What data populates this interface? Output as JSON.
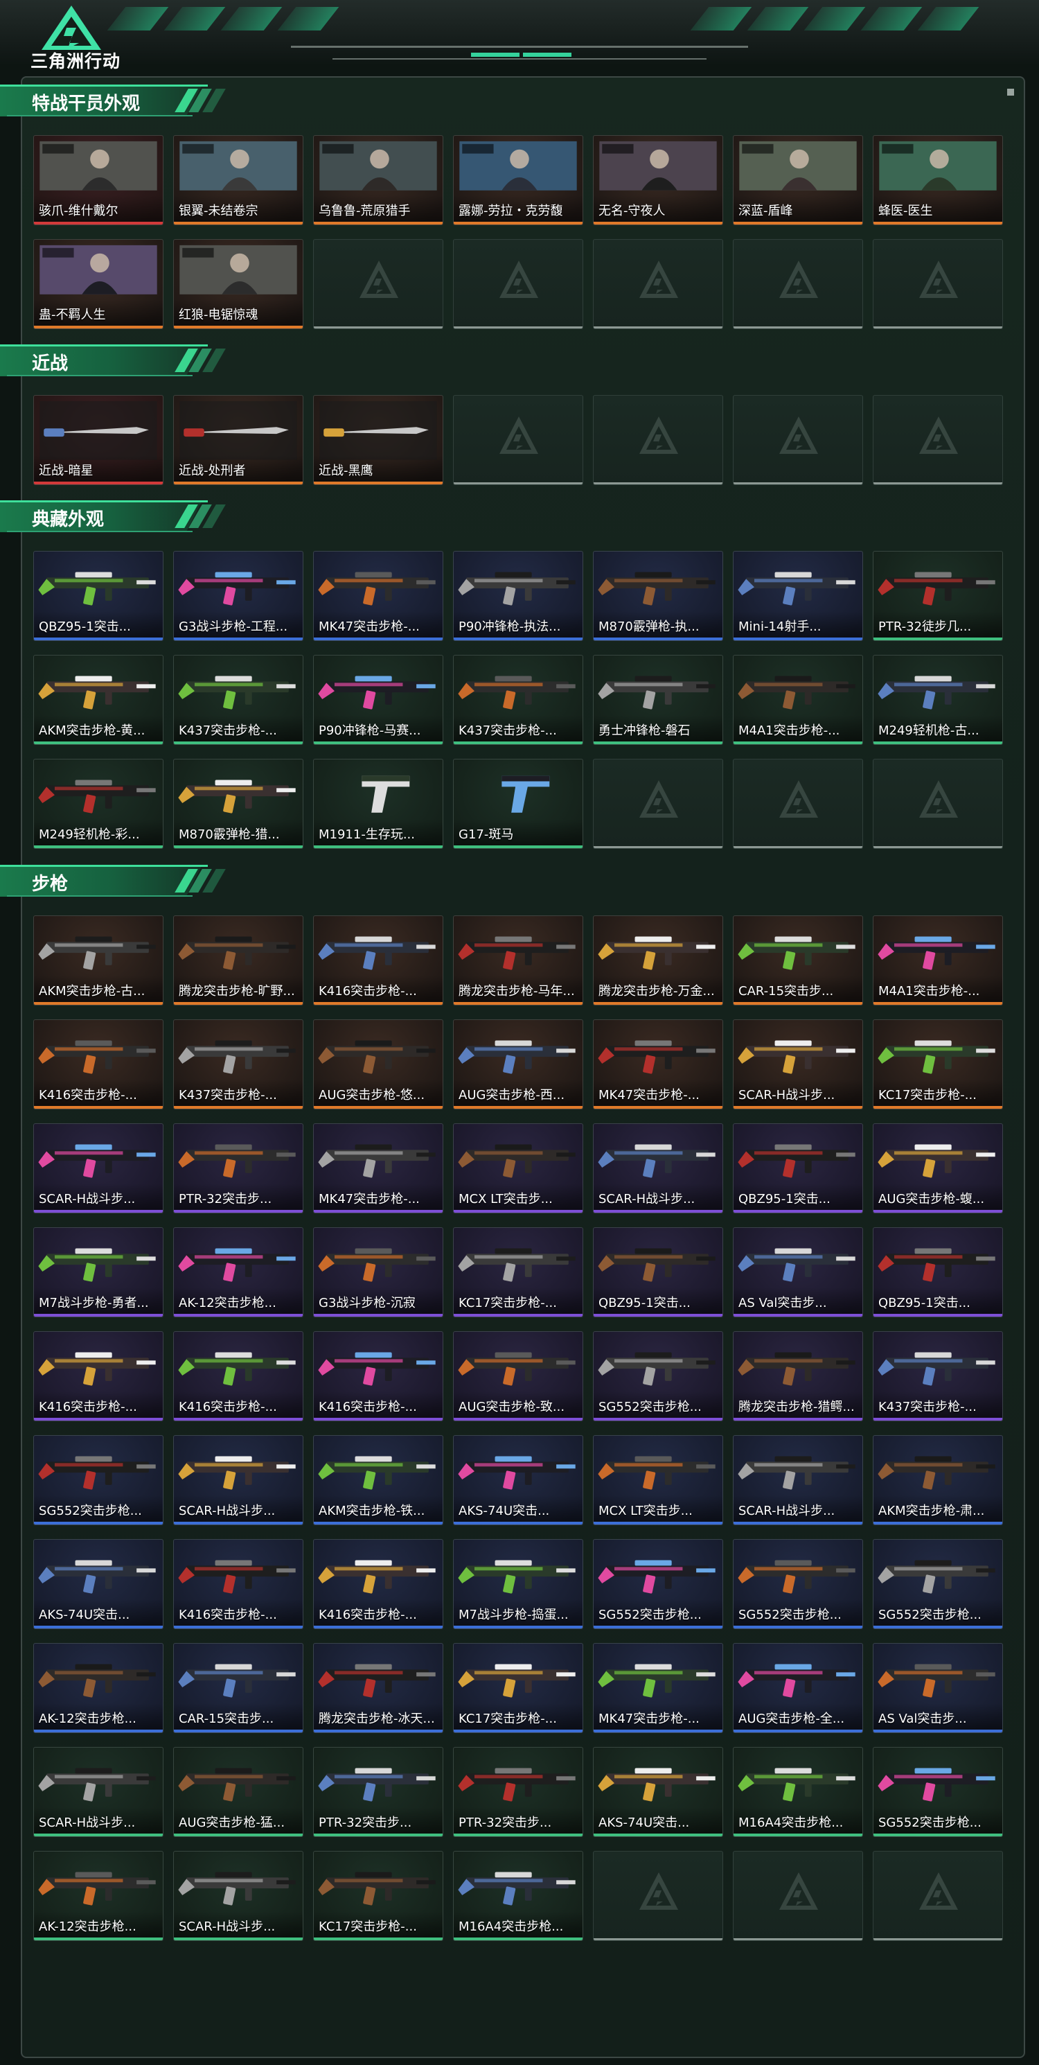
{
  "app": {
    "title": "三角洲行动"
  },
  "colors": {
    "accent": "#35d29c",
    "rarity_orange": "#e07a2a",
    "rarity_red": "#d23a3a",
    "rarity_purple": "#7d4fd6",
    "rarity_blue": "#3c6fd8",
    "rarity_green": "#3fbf7f",
    "rarity_gray": "#8c9893"
  },
  "sections": [
    {
      "title": "特战干员外观",
      "rows": 2,
      "items": [
        {
          "label": "骇爪-维什戴尔",
          "rarity": "red",
          "icon": "operator-portrait"
        },
        {
          "label": "银翼-未结卷宗",
          "rarity": "orange",
          "icon": "operator-portrait"
        },
        {
          "label": "乌鲁鲁-荒原猎手",
          "rarity": "orange",
          "icon": "operator-portrait"
        },
        {
          "label": "露娜-劳拉・克劳馥",
          "rarity": "orange",
          "icon": "operator-portrait"
        },
        {
          "label": "无名-守夜人",
          "rarity": "orange",
          "icon": "operator-portrait"
        },
        {
          "label": "深蓝-盾峰",
          "rarity": "orange",
          "icon": "operator-portrait"
        },
        {
          "label": "蜂医-医生",
          "rarity": "orange",
          "icon": "operator-portrait"
        },
        {
          "label": "蛊-不羁人生",
          "rarity": "orange",
          "icon": "operator-portrait"
        },
        {
          "label": "红狼-电锯惊魂",
          "rarity": "orange",
          "icon": "operator-portrait"
        }
      ]
    },
    {
      "title": "近战",
      "rows": 1,
      "items": [
        {
          "label": "近战-暗星",
          "rarity": "red",
          "icon": "melee-blade"
        },
        {
          "label": "近战-处刑者",
          "rarity": "orange",
          "icon": "melee-blade"
        },
        {
          "label": "近战-黑鹰",
          "rarity": "orange",
          "icon": "melee-blade"
        }
      ]
    },
    {
      "title": "典藏外观",
      "rows": 3,
      "items": [
        {
          "label": "QBZ95-1突击...",
          "rarity": "blue",
          "icon": "rifle-skin"
        },
        {
          "label": "G3战斗步枪-工程...",
          "rarity": "blue",
          "icon": "rifle-skin"
        },
        {
          "label": "MK47突击步枪-...",
          "rarity": "blue",
          "icon": "rifle-skin"
        },
        {
          "label": "P90冲锋枪-执法...",
          "rarity": "blue",
          "icon": "smg-skin"
        },
        {
          "label": "M870霰弹枪-执...",
          "rarity": "blue",
          "icon": "shotgun-skin"
        },
        {
          "label": "Mini-14射手...",
          "rarity": "blue",
          "icon": "rifle-skin"
        },
        {
          "label": "PTR-32徒步几...",
          "rarity": "green",
          "icon": "rifle-skin"
        },
        {
          "label": "AKM突击步枪-黄...",
          "rarity": "green",
          "icon": "rifle-skin"
        },
        {
          "label": "K437突击步枪-...",
          "rarity": "green",
          "icon": "rifle-skin"
        },
        {
          "label": "P90冲锋枪-马赛...",
          "rarity": "green",
          "icon": "smg-skin"
        },
        {
          "label": "K437突击步枪-...",
          "rarity": "green",
          "icon": "rifle-skin"
        },
        {
          "label": "勇士冲锋枪-磐石",
          "rarity": "green",
          "icon": "smg-skin"
        },
        {
          "label": "M4A1突击步枪-...",
          "rarity": "green",
          "icon": "rifle-skin"
        },
        {
          "label": "M249轻机枪-古...",
          "rarity": "green",
          "icon": "rifle-skin"
        },
        {
          "label": "M249轻机枪-彩...",
          "rarity": "green",
          "icon": "rifle-skin"
        },
        {
          "label": "M870霰弹枪-猎...",
          "rarity": "green",
          "icon": "shotgun-skin"
        },
        {
          "label": "M1911-生存玩...",
          "rarity": "green",
          "icon": "pistol-skin"
        },
        {
          "label": "G17-斑马",
          "rarity": "green",
          "icon": "pistol-skin"
        }
      ]
    },
    {
      "title": "步枪",
      "rows": 10,
      "items": [
        {
          "label": "AKM突击步枪-古...",
          "rarity": "orange",
          "icon": "rifle-skin"
        },
        {
          "label": "腾龙突击步枪-旷野...",
          "rarity": "orange",
          "icon": "rifle-skin"
        },
        {
          "label": "K416突击步枪-...",
          "rarity": "orange",
          "icon": "rifle-skin"
        },
        {
          "label": "腾龙突击步枪-马年...",
          "rarity": "orange",
          "icon": "rifle-skin"
        },
        {
          "label": "腾龙突击步枪-万金...",
          "rarity": "orange",
          "icon": "rifle-skin"
        },
        {
          "label": "CAR-15突击步...",
          "rarity": "orange",
          "icon": "rifle-skin"
        },
        {
          "label": "M4A1突击步枪-...",
          "rarity": "orange",
          "icon": "rifle-skin"
        },
        {
          "label": "K416突击步枪-...",
          "rarity": "orange",
          "icon": "rifle-skin"
        },
        {
          "label": "K437突击步枪-...",
          "rarity": "orange",
          "icon": "rifle-skin"
        },
        {
          "label": "AUG突击步枪-悠...",
          "rarity": "orange",
          "icon": "rifle-skin"
        },
        {
          "label": "AUG突击步枪-西...",
          "rarity": "orange",
          "icon": "rifle-skin"
        },
        {
          "label": "MK47突击步枪-...",
          "rarity": "orange",
          "icon": "rifle-skin"
        },
        {
          "label": "SCAR-H战斗步...",
          "rarity": "orange",
          "icon": "rifle-skin"
        },
        {
          "label": "KC17突击步枪-...",
          "rarity": "orange",
          "icon": "rifle-skin"
        },
        {
          "label": "SCAR-H战斗步...",
          "rarity": "purple",
          "icon": "rifle-skin"
        },
        {
          "label": "PTR-32突击步...",
          "rarity": "purple",
          "icon": "rifle-skin"
        },
        {
          "label": "MK47突击步枪-...",
          "rarity": "purple",
          "icon": "rifle-skin"
        },
        {
          "label": "MCX LT突击步...",
          "rarity": "purple",
          "icon": "rifle-skin"
        },
        {
          "label": "SCAR-H战斗步...",
          "rarity": "purple",
          "icon": "rifle-skin"
        },
        {
          "label": "QBZ95-1突击...",
          "rarity": "purple",
          "icon": "rifle-skin"
        },
        {
          "label": "AUG突击步枪-蝮...",
          "rarity": "purple",
          "icon": "rifle-skin"
        },
        {
          "label": "M7战斗步枪-勇者...",
          "rarity": "purple",
          "icon": "rifle-skin"
        },
        {
          "label": "AK-12突击步枪...",
          "rarity": "purple",
          "icon": "rifle-skin"
        },
        {
          "label": "G3战斗步枪-沉寂",
          "rarity": "purple",
          "icon": "rifle-skin"
        },
        {
          "label": "KC17突击步枪-...",
          "rarity": "purple",
          "icon": "rifle-skin"
        },
        {
          "label": "QBZ95-1突击...",
          "rarity": "purple",
          "icon": "rifle-skin"
        },
        {
          "label": "AS Val突击步...",
          "rarity": "purple",
          "icon": "rifle-skin"
        },
        {
          "label": "QBZ95-1突击...",
          "rarity": "purple",
          "icon": "rifle-skin"
        },
        {
          "label": "K416突击步枪-...",
          "rarity": "purple",
          "icon": "rifle-skin"
        },
        {
          "label": "K416突击步枪-...",
          "rarity": "purple",
          "icon": "rifle-skin"
        },
        {
          "label": "K416突击步枪-...",
          "rarity": "purple",
          "icon": "rifle-skin"
        },
        {
          "label": "AUG突击步枪-致...",
          "rarity": "purple",
          "icon": "rifle-skin"
        },
        {
          "label": "SG552突击步枪...",
          "rarity": "purple",
          "icon": "rifle-skin"
        },
        {
          "label": "腾龙突击步枪-猎鳄...",
          "rarity": "purple",
          "icon": "rifle-skin"
        },
        {
          "label": "K437突击步枪-...",
          "rarity": "purple",
          "icon": "rifle-skin"
        },
        {
          "label": "SG552突击步枪...",
          "rarity": "blue",
          "icon": "rifle-skin"
        },
        {
          "label": "SCAR-H战斗步...",
          "rarity": "blue",
          "icon": "rifle-skin"
        },
        {
          "label": "AKM突击步枪-铁...",
          "rarity": "blue",
          "icon": "rifle-skin"
        },
        {
          "label": "AKS-74U突击...",
          "rarity": "blue",
          "icon": "rifle-skin"
        },
        {
          "label": "MCX LT突击步...",
          "rarity": "blue",
          "icon": "rifle-skin"
        },
        {
          "label": "SCAR-H战斗步...",
          "rarity": "blue",
          "icon": "rifle-skin"
        },
        {
          "label": "AKM突击步枪-肃...",
          "rarity": "blue",
          "icon": "rifle-skin"
        },
        {
          "label": "AKS-74U突击...",
          "rarity": "blue",
          "icon": "rifle-skin"
        },
        {
          "label": "K416突击步枪-...",
          "rarity": "blue",
          "icon": "rifle-skin"
        },
        {
          "label": "K416突击步枪-...",
          "rarity": "blue",
          "icon": "rifle-skin"
        },
        {
          "label": "M7战斗步枪-捣蛋...",
          "rarity": "blue",
          "icon": "rifle-skin"
        },
        {
          "label": "SG552突击步枪...",
          "rarity": "blue",
          "icon": "rifle-skin"
        },
        {
          "label": "SG552突击步枪...",
          "rarity": "blue",
          "icon": "rifle-skin"
        },
        {
          "label": "SG552突击步枪...",
          "rarity": "blue",
          "icon": "rifle-skin"
        },
        {
          "label": "AK-12突击步枪...",
          "rarity": "blue",
          "icon": "rifle-skin"
        },
        {
          "label": "CAR-15突击步...",
          "rarity": "blue",
          "icon": "rifle-skin"
        },
        {
          "label": "腾龙突击步枪-冰天...",
          "rarity": "blue",
          "icon": "rifle-skin"
        },
        {
          "label": "KC17突击步枪-...",
          "rarity": "blue",
          "icon": "rifle-skin"
        },
        {
          "label": "MK47突击步枪-...",
          "rarity": "blue",
          "icon": "rifle-skin"
        },
        {
          "label": "AUG突击步枪-全...",
          "rarity": "blue",
          "icon": "rifle-skin"
        },
        {
          "label": "AS Val突击步...",
          "rarity": "blue",
          "icon": "rifle-skin"
        },
        {
          "label": "SCAR-H战斗步...",
          "rarity": "green",
          "icon": "rifle-skin"
        },
        {
          "label": "AUG突击步枪-猛...",
          "rarity": "green",
          "icon": "rifle-skin"
        },
        {
          "label": "PTR-32突击步...",
          "rarity": "green",
          "icon": "rifle-skin"
        },
        {
          "label": "PTR-32突击步...",
          "rarity": "green",
          "icon": "rifle-skin"
        },
        {
          "label": "AKS-74U突击...",
          "rarity": "green",
          "icon": "rifle-skin"
        },
        {
          "label": "M16A4突击步枪...",
          "rarity": "green",
          "icon": "rifle-skin"
        },
        {
          "label": "SG552突击步枪...",
          "rarity": "green",
          "icon": "rifle-skin"
        },
        {
          "label": "AK-12突击步枪...",
          "rarity": "green",
          "icon": "rifle-skin"
        },
        {
          "label": "SCAR-H战斗步...",
          "rarity": "green",
          "icon": "rifle-skin"
        },
        {
          "label": "KC17突击步枪-...",
          "rarity": "green",
          "icon": "rifle-skin"
        },
        {
          "label": "M16A4突击步枪...",
          "rarity": "green",
          "icon": "rifle-skin"
        }
      ]
    }
  ]
}
